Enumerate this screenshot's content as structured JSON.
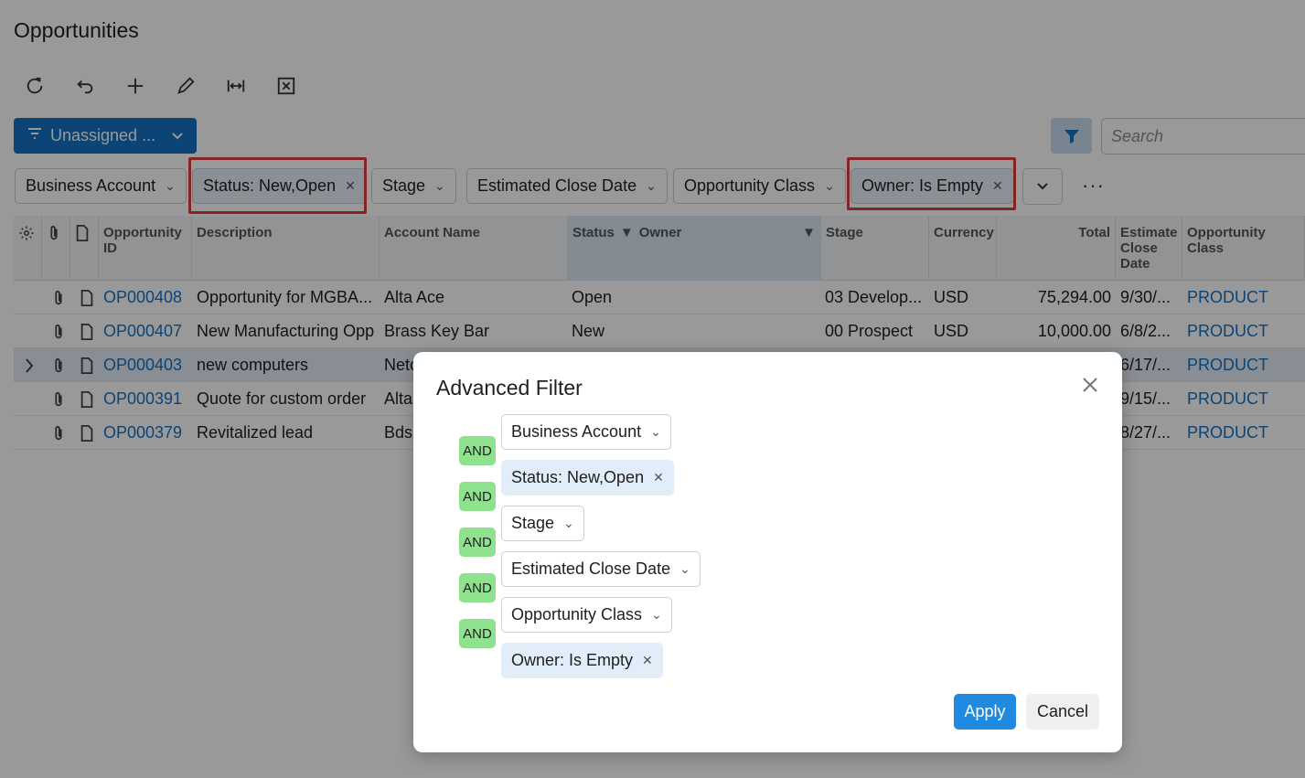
{
  "page": {
    "title": "Opportunities"
  },
  "toolbar": {
    "buttons": [
      {
        "icon": "refresh-icon"
      },
      {
        "icon": "undo-icon"
      },
      {
        "icon": "add-icon"
      },
      {
        "icon": "edit-icon"
      },
      {
        "icon": "fit-width-icon"
      },
      {
        "icon": "export-excel-icon"
      }
    ]
  },
  "view": {
    "label": "Unassigned ..."
  },
  "search": {
    "placeholder": "Search"
  },
  "filters": {
    "business_account": "Business Account",
    "status": "Status: New,Open",
    "stage": "Stage",
    "estimated_close_date": "Estimated Close Date",
    "opportunity_class": "Opportunity Class",
    "owner": "Owner: Is Empty",
    "more": "···"
  },
  "grid": {
    "headers": {
      "opportunity_id": "Opportunity ID",
      "description": "Description",
      "account_name": "Account Name",
      "status": "Status",
      "owner": "Owner",
      "stage": "Stage",
      "currency": "Currency",
      "total": "Total",
      "estimated_close_date": "Estimate Close Date",
      "opportunity_class": "Opportunity Class"
    },
    "rows": [
      {
        "id": "OP000408",
        "description": "Opportunity for MGBA...",
        "account": "Alta Ace",
        "status": "Open",
        "stage": "03 Develop...",
        "currency": "USD",
        "total": "75,294.00",
        "close_date": "9/30/...",
        "class": "PRODUCT"
      },
      {
        "id": "OP000407",
        "description": "New Manufacturing Opp",
        "account": "Brass Key Bar",
        "status": "New",
        "stage": "00 Prospect",
        "currency": "USD",
        "total": "10,000.00",
        "close_date": "6/8/2...",
        "class": "PRODUCT"
      },
      {
        "id": "OP000403",
        "description": "new computers",
        "account": "Neto",
        "status": "",
        "stage": "",
        "currency": "",
        "total": "",
        "close_date": "6/17/...",
        "class": "PRODUCT"
      },
      {
        "id": "OP000391",
        "description": "Quote for custom order",
        "account": "Alta",
        "status": "",
        "stage": "",
        "currency": "",
        "total": "",
        "close_date": "9/15/...",
        "class": "PRODUCT"
      },
      {
        "id": "OP000379",
        "description": "Revitalized lead",
        "account": "Bds",
        "status": "",
        "stage": "",
        "currency": "",
        "total": "",
        "close_date": "8/27/...",
        "class": "PRODUCT"
      }
    ]
  },
  "dialog": {
    "title": "Advanced Filter",
    "operator": "AND",
    "conditions": [
      "Business Account",
      "Status: New,Open",
      "Stage",
      "Estimated Close Date",
      "Opportunity Class",
      "Owner: Is Empty"
    ],
    "apply_label": "Apply",
    "cancel_label": "Cancel"
  },
  "colors": {
    "accent": "#1572c4",
    "and_badge": "#8ee28e",
    "highlight": "#e03b3b"
  }
}
